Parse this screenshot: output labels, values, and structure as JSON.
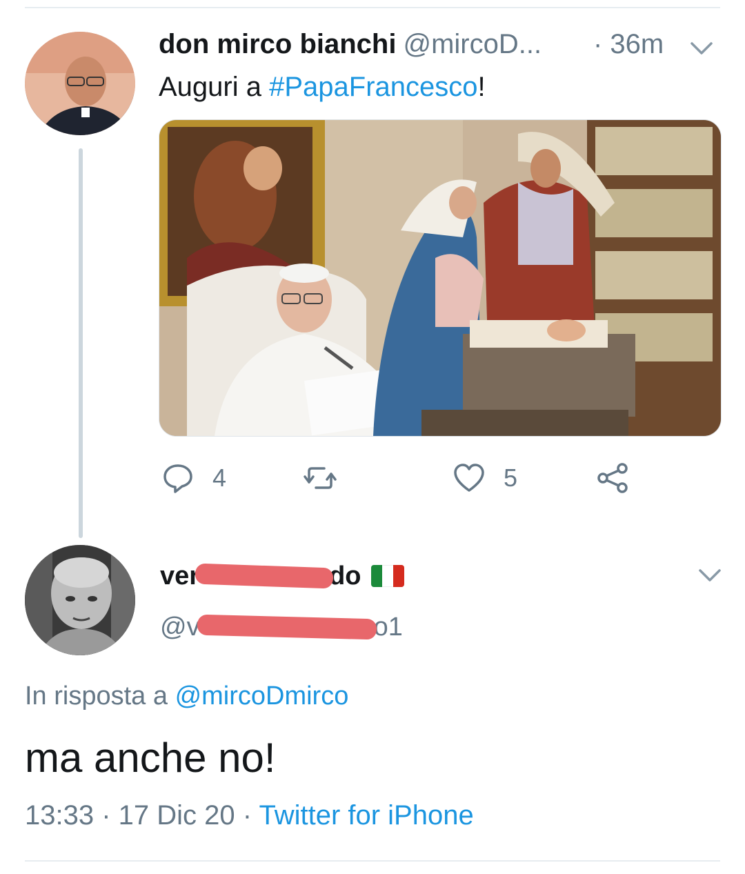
{
  "tweet1": {
    "display_name": "don mirco bianchi",
    "handle": "@mircoD...",
    "time": "· 36m",
    "text_prefix": "Auguri a ",
    "hashtag": "#PapaFrancesco",
    "text_suffix": "!",
    "reply_count": "4",
    "like_count": "5"
  },
  "tweet2": {
    "name_start": "ver",
    "name_end": "do",
    "flag": "it-flag",
    "handle_start": "@v",
    "handle_end": "o1",
    "reply_prefix": "In risposta a ",
    "reply_mention": "@mircoDmirco",
    "text": "ma anche no!",
    "time": "13:33",
    "sep1": " · ",
    "date": "17 Dic 20",
    "sep2": " · ",
    "source": "Twitter for iPhone"
  },
  "colors": {
    "link": "#1b95e0",
    "muted": "#657786",
    "redaction": "#e8676b"
  },
  "icons": {
    "reply": "reply-icon",
    "retweet": "retweet-icon",
    "like": "heart-icon",
    "share": "share-icon",
    "more": "chevron-down-icon"
  }
}
